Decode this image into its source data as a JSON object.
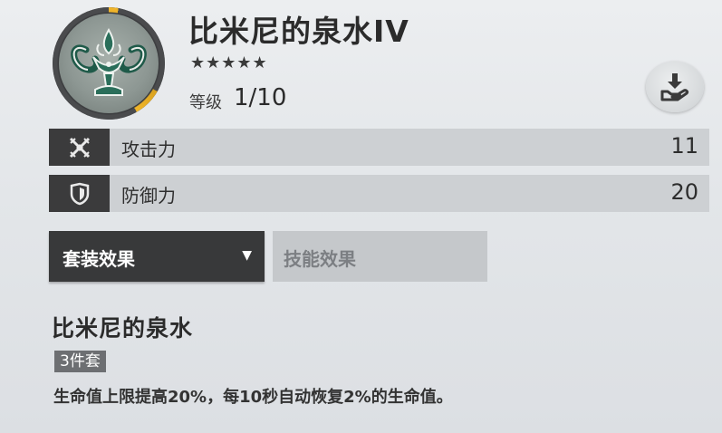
{
  "item": {
    "title": "比米尼的泉水IV",
    "stars": "★★★★★",
    "level_label": "等级",
    "level_value": "1/10"
  },
  "icons": {
    "emblem": "fountain-emblem-icon",
    "lock": "hand-download-icon",
    "attack": "crossed-swords-icon",
    "defense": "shield-icon",
    "caret": "caret-down-icon"
  },
  "stats": [
    {
      "label": "攻击力",
      "value": "11"
    },
    {
      "label": "防御力",
      "value": "20"
    }
  ],
  "tabs": [
    {
      "label": "套装效果",
      "caret": "▼",
      "active": true
    },
    {
      "label": "技能效果",
      "active": false
    }
  ],
  "set_effect": {
    "name": "比米尼的泉水",
    "badge": "3件套",
    "description": "生命值上限提高20%，每10秒自动恢复2%的生命值。"
  },
  "colors": {
    "accent_gold": "#f0b429",
    "emblem_green": "#1f5a49",
    "dark_tab": "#38393a",
    "row_bg": "#cdd0d3"
  }
}
